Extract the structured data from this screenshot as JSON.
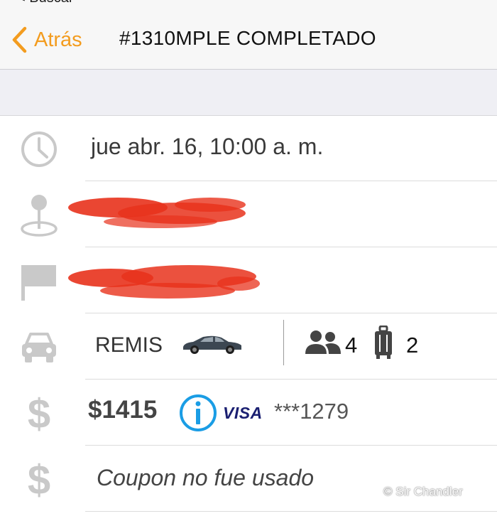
{
  "nav": {
    "back_small_label": "< Buscar",
    "back_label": "Atrás",
    "title": "#1310MPLE COMPLETADO"
  },
  "trip": {
    "datetime": "jue abr. 16, 10:00 a. m.",
    "vehicle_type": "REMIS",
    "passengers": "4",
    "luggage": "2",
    "price": "$1415",
    "card_brand": "VISA",
    "card_number": "***1279",
    "coupon": "Coupon no fue usado"
  },
  "colors": {
    "accent": "#f39c1f",
    "icon_gray": "#c9c9c9",
    "info_blue": "#1a9de5",
    "redaction": "#e8321c"
  },
  "icons": [
    "chevron-left-icon",
    "clock-icon",
    "map-pin-icon",
    "flag-icon",
    "car-icon",
    "sedan-icon",
    "people-icon",
    "luggage-icon",
    "dollar-icon",
    "info-icon"
  ],
  "watermark": "© Sir Chandler"
}
